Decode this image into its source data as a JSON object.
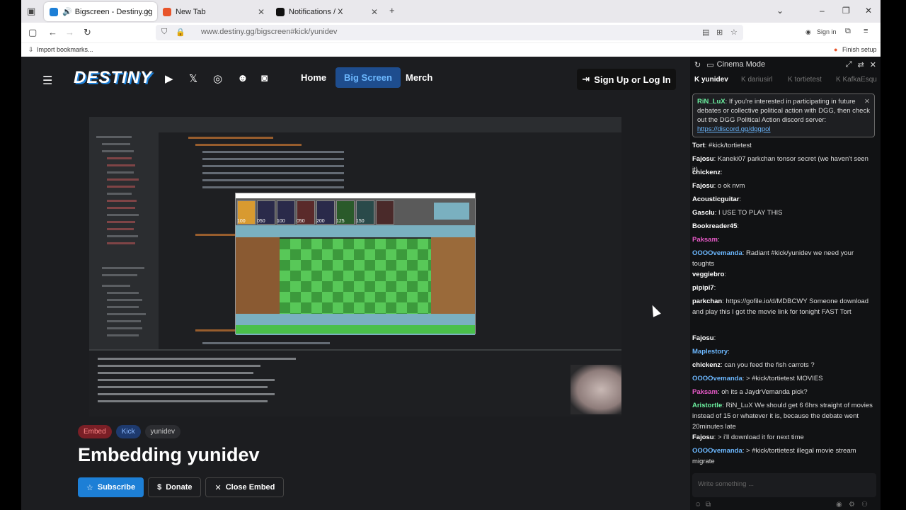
{
  "browser": {
    "tabs": [
      {
        "label": "Bigscreen - Destiny.gg",
        "active": true
      },
      {
        "label": "New Tab",
        "active": false
      },
      {
        "label": "Notifications / X",
        "active": false
      }
    ],
    "url": "www.destiny.gg/bigscreen#kick/yunidev",
    "sign_in": "Sign in",
    "bookmark_import": "Import bookmarks...",
    "finish_setup": "Finish setup"
  },
  "site": {
    "logo": "DESTINY",
    "nav": [
      "Home",
      "Big Screen",
      "Merch"
    ],
    "signup": "Sign Up or Log In"
  },
  "embed": {
    "tags": [
      "Embed",
      "Kick",
      "yunidev"
    ],
    "title": "Embedding yunidev",
    "subscribe": "Subscribe",
    "donate": "Donate",
    "close": "Close Embed"
  },
  "game": {
    "costs": [
      "100",
      "050",
      "100",
      "050",
      "200",
      "125",
      "150"
    ]
  },
  "chat": {
    "header": "Cinema Mode",
    "tabs": [
      "yunidev",
      "dariusirl",
      "tortietest",
      "KafkaEsqu"
    ],
    "notice_user": "RiN_LuX",
    "notice_text": ": If you're interested in participating in future debates or collective political action with DGG, then check out the DGG Political Action discord server: ",
    "notice_link": "https://discord.gg/dggpol",
    "messages": [
      {
        "user": "Tort",
        "text": ": #kick/tortietest",
        "color": "#fff"
      },
      {
        "user": "Fajosu",
        "text": ": Kaneki07 parkchan tonsor secret (we haven't seen it)",
        "color": "#fff"
      },
      {
        "user": "chickenz",
        "text": ":",
        "color": "#fff"
      },
      {
        "user": "Fajosu",
        "text": ": o ok nvm",
        "color": "#fff"
      },
      {
        "user": "Acousticguitar",
        "text": ":",
        "color": "#fff"
      },
      {
        "user": "Gasclu",
        "text": ": I USE TO PLAY THIS",
        "color": "#fff"
      },
      {
        "user": "Bookreader45",
        "text": ":",
        "color": "#fff"
      },
      {
        "user": "Paksam",
        "text": ":",
        "color": "#e85ac8"
      },
      {
        "user": "OOOOvemanda",
        "text": ": Radiant #kick/yunidev we need your toughts",
        "color": "#6cb8ff"
      },
      {
        "user": "veggiebro",
        "text": ":",
        "color": "#fff"
      },
      {
        "user": "pipipi7",
        "text": ":",
        "color": "#fff"
      },
      {
        "user": "parkchan",
        "text": ": https://gofile.io/d/MDBCWY Someone download and play this   I got the movie link for tonight FAST Tort",
        "color": "#fff"
      },
      {
        "user": "Fajosu",
        "text": ":",
        "color": "#fff"
      },
      {
        "user": "Maplestory",
        "text": ":",
        "color": "#6cb8ff"
      },
      {
        "user": "chickenz",
        "text": ": can you feed the fish carrots ?",
        "color": "#fff"
      },
      {
        "user": "OOOOvemanda",
        "text": ": > #kick/tortietest MOVIES",
        "color": "#6cb8ff"
      },
      {
        "user": "Paksam",
        "text": ": oh   its a JaydrVemanda pick?",
        "color": "#e85ac8"
      },
      {
        "user": "Aristortle",
        "text": ": RiN_LuX We should get 6 6hrs straight of movies instead of 15 or whatever it is, because the debate went 20minutes late",
        "color": "#6cf0a0"
      },
      {
        "user": "Fajosu",
        "text": ": >   i'll download it for next time",
        "color": "#fff"
      },
      {
        "user": "OOOOvemanda",
        "text": ": > #kick/tortietest illegal movie stream   migrate",
        "color": "#6cb8ff"
      }
    ],
    "input_placeholder": "Write something ..."
  }
}
